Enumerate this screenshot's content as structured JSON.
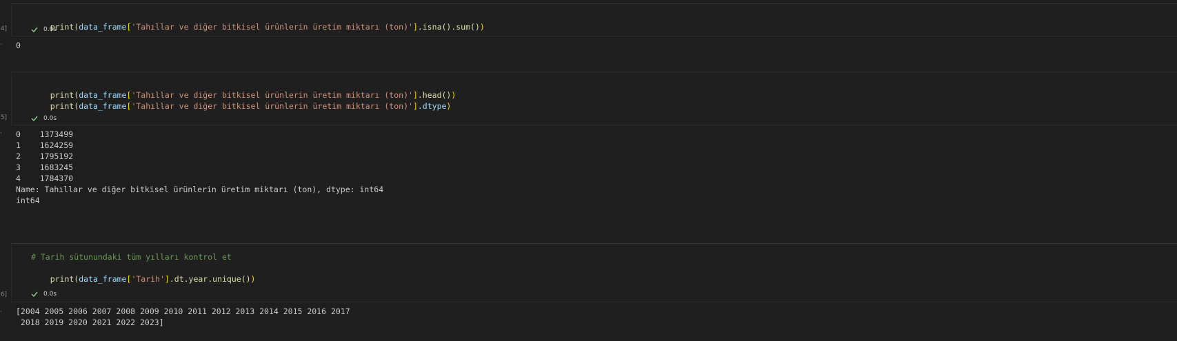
{
  "cells": [
    {
      "exec_label": "4]",
      "code": [
        {
          "pre": "print(",
          "obj": "data_frame",
          "open": "[",
          "str": "'Tahıllar ve diğer bitkisel ürünlerin üretim miktarı (ton)'",
          "close": "]",
          "method": ".isna().sum()",
          "end": ")"
        }
      ],
      "time": "0.0s",
      "output": [
        "0"
      ]
    },
    {
      "exec_label": "5]",
      "code": [
        {
          "pre": "print(",
          "obj": "data_frame",
          "open": "[",
          "str": "'Tahıllar ve diğer bitkisel ürünlerin üretim miktarı (ton)'",
          "close": "]",
          "method": ".head()",
          "end": ")"
        },
        {
          "pre": "print(",
          "obj": "data_frame",
          "open": "[",
          "str": "'Tahıllar ve diğer bitkisel ürünlerin üretim miktarı (ton)'",
          "close": "]",
          "method": ".dtype",
          "end": ")"
        }
      ],
      "time": "0.0s",
      "output": [
        "0    1373499",
        "1    1624259",
        "2    1795192",
        "3    1683245",
        "4    1784370",
        "Name: Tahıllar ve diğer bitkisel ürünlerin üretim miktarı (ton), dtype: int64",
        "int64"
      ]
    },
    {
      "exec_label": "6]",
      "comment": "# Tarih sütunundaki tüm yılları kontrol et",
      "code2": {
        "pre": "print(",
        "obj": "data_frame",
        "open": "[",
        "str": "'Tarih'",
        "close": "]",
        "method": ".dt.year.unique()",
        "end": ")"
      },
      "time": "0.0s",
      "output": [
        "[2004 2005 2006 2007 2008 2009 2010 2011 2012 2013 2014 2015 2016 2017",
        " 2018 2019 2020 2021 2022 2023]"
      ]
    }
  ],
  "colors": {
    "check": "#89d185",
    "background": "#1e1e1e",
    "cell": "#1f1f1f"
  }
}
